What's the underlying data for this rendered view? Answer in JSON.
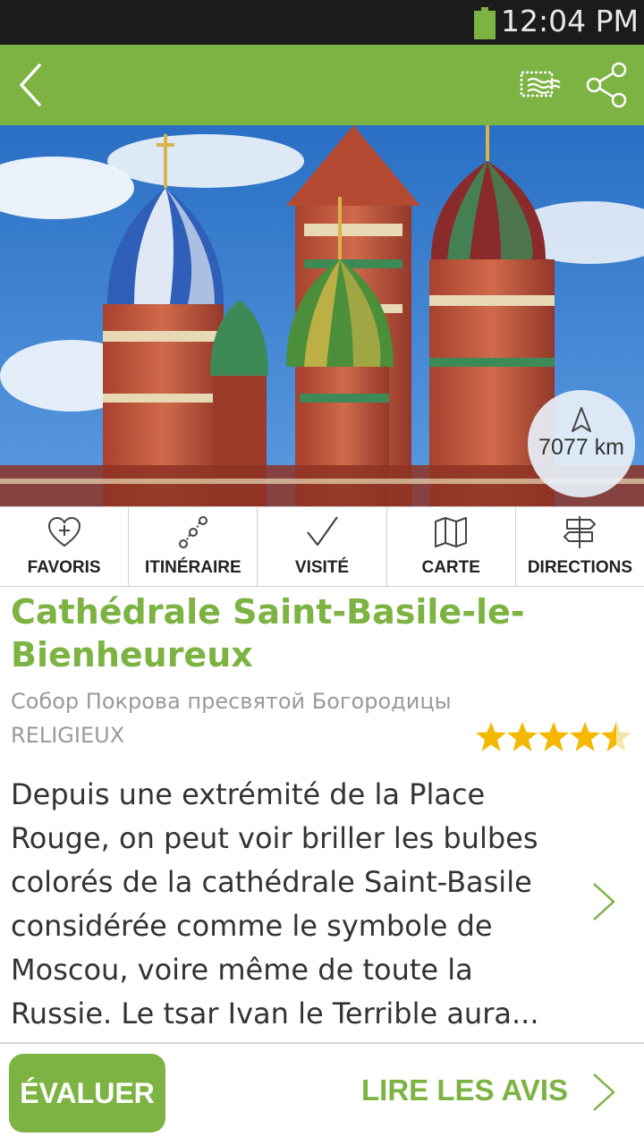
{
  "status_bar": {
    "time": "12:04 PM"
  },
  "colors": {
    "accent": "#7cb342",
    "status_bar": "#1b1b1b",
    "text": "#333333",
    "muted": "#9a9a9a",
    "star": "#f5b800"
  },
  "app_bar": {
    "icons": [
      "back-arrow-icon",
      "postcard-icon",
      "share-icon"
    ]
  },
  "hero": {
    "distance": "7077 km",
    "image": "photo of Saint Basil's Cathedral domes under blue sky"
  },
  "actions": [
    {
      "label": "FAVORIS",
      "icon": "heart-plus-icon"
    },
    {
      "label": "ITINÉRAIRE",
      "icon": "route-icon"
    },
    {
      "label": "VISITÉ",
      "icon": "checkmark-icon"
    },
    {
      "label": "CARTE",
      "icon": "map-icon"
    },
    {
      "label": "DIRECTIONS",
      "icon": "signpost-icon"
    }
  ],
  "place": {
    "title": "Cathédrale Saint-Basile-le-Bienheureux",
    "local_name": "Собор Покрова пресвятой Богородицы",
    "category": "RELIGIEUX",
    "rating": 4.5,
    "rating_max": 5,
    "description": "Depuis une extrémité de la Place Rouge, on peut voir briller les bulbes colorés de la cathédrale Saint-Basile considérée comme le symbole de Moscou, voire même de toute la Russie. Le tsar Ivan le Terrible aura..."
  },
  "footer": {
    "rate_button": "ÉVALUER",
    "reviews_link": "LIRE LES AVIS"
  }
}
